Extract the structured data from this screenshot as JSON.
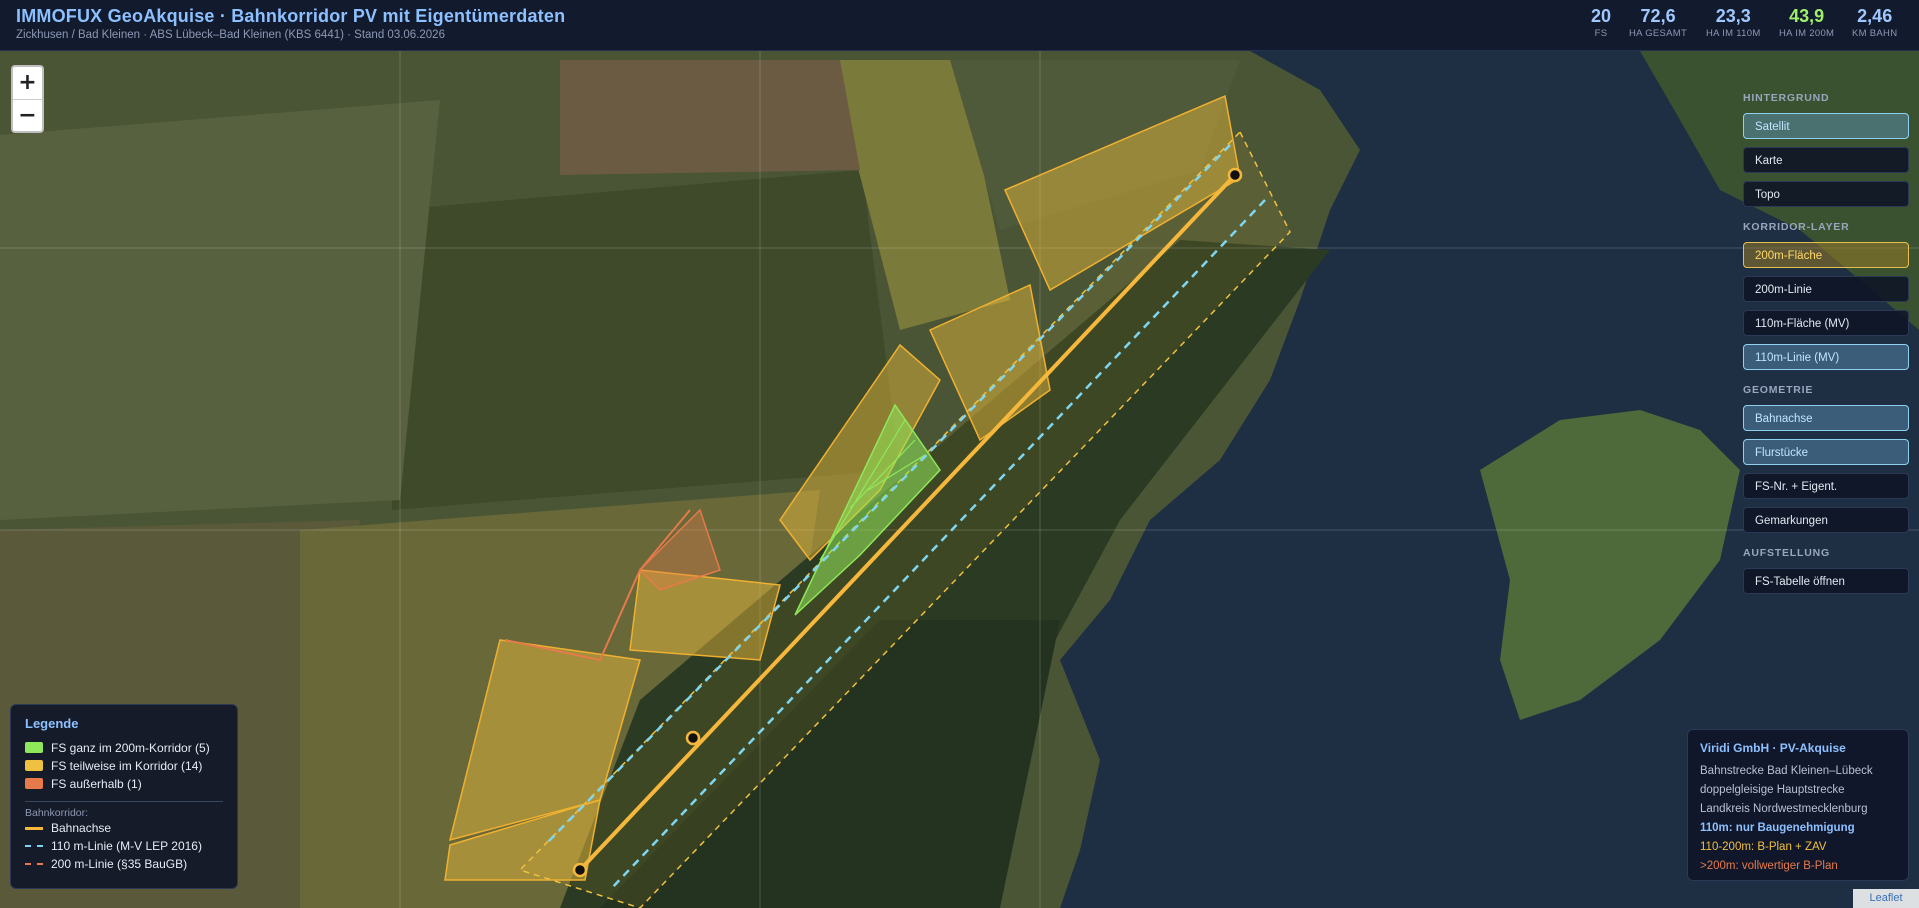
{
  "header": {
    "title": "IMMOFUX GeoAkquise · Bahnkorridor PV mit Eigentümerdaten",
    "subtitle": "Zickhusen / Bad Kleinen · ABS Lübeck–Bad Kleinen (KBS 6441) · Stand 03.06.2026",
    "stats": [
      {
        "value": "20",
        "label": "FS"
      },
      {
        "value": "72,6",
        "label": "HA GESAMT"
      },
      {
        "value": "23,3",
        "label": "HA IM 110M"
      },
      {
        "value": "43,9",
        "label": "HA IM 200M"
      },
      {
        "value": "2,46",
        "label": "KM BAHN"
      }
    ]
  },
  "zoom": {
    "in": "+",
    "out": "−"
  },
  "panel": {
    "background_title": "HINTERGRUND",
    "background": [
      "Satellit",
      "Karte",
      "Topo"
    ],
    "corridor_title": "KORRIDOR-LAYER",
    "corridor": [
      "200m-Fläche",
      "200m-Linie",
      "110m-Fläche (MV)",
      "110m-Linie (MV)"
    ],
    "geometry_title": "GEOMETRIE",
    "geometry": [
      "Bahnachse",
      "Flurstücke",
      "FS-Nr. + Eigent.",
      "Gemarkungen"
    ],
    "listing_title": "AUFSTELLUNG",
    "listing": [
      "FS-Tabelle öffnen"
    ]
  },
  "legend": {
    "title": "Legende",
    "items": [
      {
        "label": "FS ganz im 200m-Korridor (5)",
        "color": "#8fe85a"
      },
      {
        "label": "FS teilweise im Korridor (14)",
        "color": "#f0c040"
      },
      {
        "label": "FS außerhalb (1)",
        "color": "#e67a4a"
      }
    ],
    "corridor_title": "Bahnkorridor:",
    "lines": [
      {
        "label": "Bahnachse",
        "color": "#f5b83c"
      },
      {
        "label": "110 m-Linie (M-V LEP 2016)",
        "color": "#7fd6f0"
      },
      {
        "label": "200 m-Linie (§35 BauGB)",
        "color": "#e67a4a"
      }
    ]
  },
  "info": {
    "title": "Viridi GmbH · PV-Akquise",
    "lines": [
      "Bahnstrecke Bad Kleinen–Lübeck",
      "doppelgleisige Hauptstrecke",
      "Landkreis Nordwestmecklenburg"
    ],
    "rules": [
      {
        "text": "110m: nur Baugenehmigung",
        "color": "#8cc0ff"
      },
      {
        "text": "110-200m: B-Plan + ZAV",
        "color": "#f0c040"
      },
      {
        "text": ">200m: vollwertiger B-Plan",
        "color": "#e67a4a"
      }
    ]
  },
  "attribution": "Leaflet"
}
